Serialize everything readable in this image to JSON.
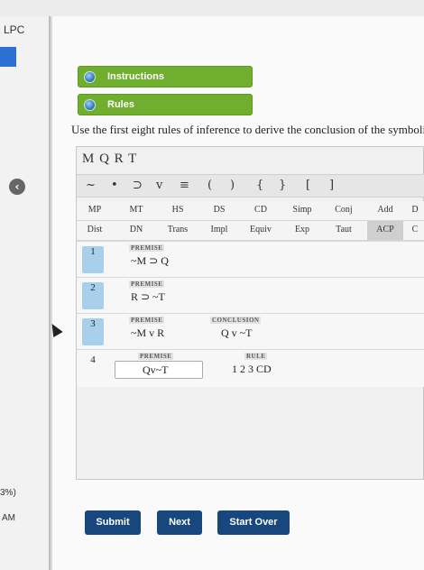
{
  "sidebar": {
    "title": "LPC",
    "progress": "3%)",
    "time": "AM"
  },
  "buttons": {
    "instructions": "Instructions",
    "rules": "Rules"
  },
  "instruction_text": "Use the first eight rules of inference to derive the conclusion of the symboli",
  "variables": "M Q R T",
  "symbols": [
    "~",
    "•",
    "⊃",
    "v",
    "≡",
    "(",
    ")",
    "{",
    "}",
    "[",
    "]"
  ],
  "rule_rows": [
    [
      "MP",
      "MT",
      "HS",
      "DS",
      "CD",
      "Simp",
      "Conj",
      "Add",
      "D"
    ],
    [
      "Dist",
      "DN",
      "Trans",
      "Impl",
      "Equiv",
      "Exp",
      "Taut",
      "ACP",
      "C"
    ]
  ],
  "proof_lines": [
    {
      "num": "1",
      "tag": "PREMISE",
      "formula": "~M ⊃ Q"
    },
    {
      "num": "2",
      "tag": "PREMISE",
      "formula": "R ⊃ ~T"
    },
    {
      "num": "3",
      "tag": "PREMISE",
      "formula": "~M v R",
      "concl_tag": "CONCLUSION",
      "conclusion": "Q v ~T"
    },
    {
      "num": "4",
      "tag": "PREMISE",
      "formula": "Qv~T",
      "rule_tag": "RULE",
      "rule": "1 2 3 CD"
    }
  ],
  "footer": {
    "submit": "Submit",
    "next": "Next",
    "start_over": "Start Over"
  }
}
